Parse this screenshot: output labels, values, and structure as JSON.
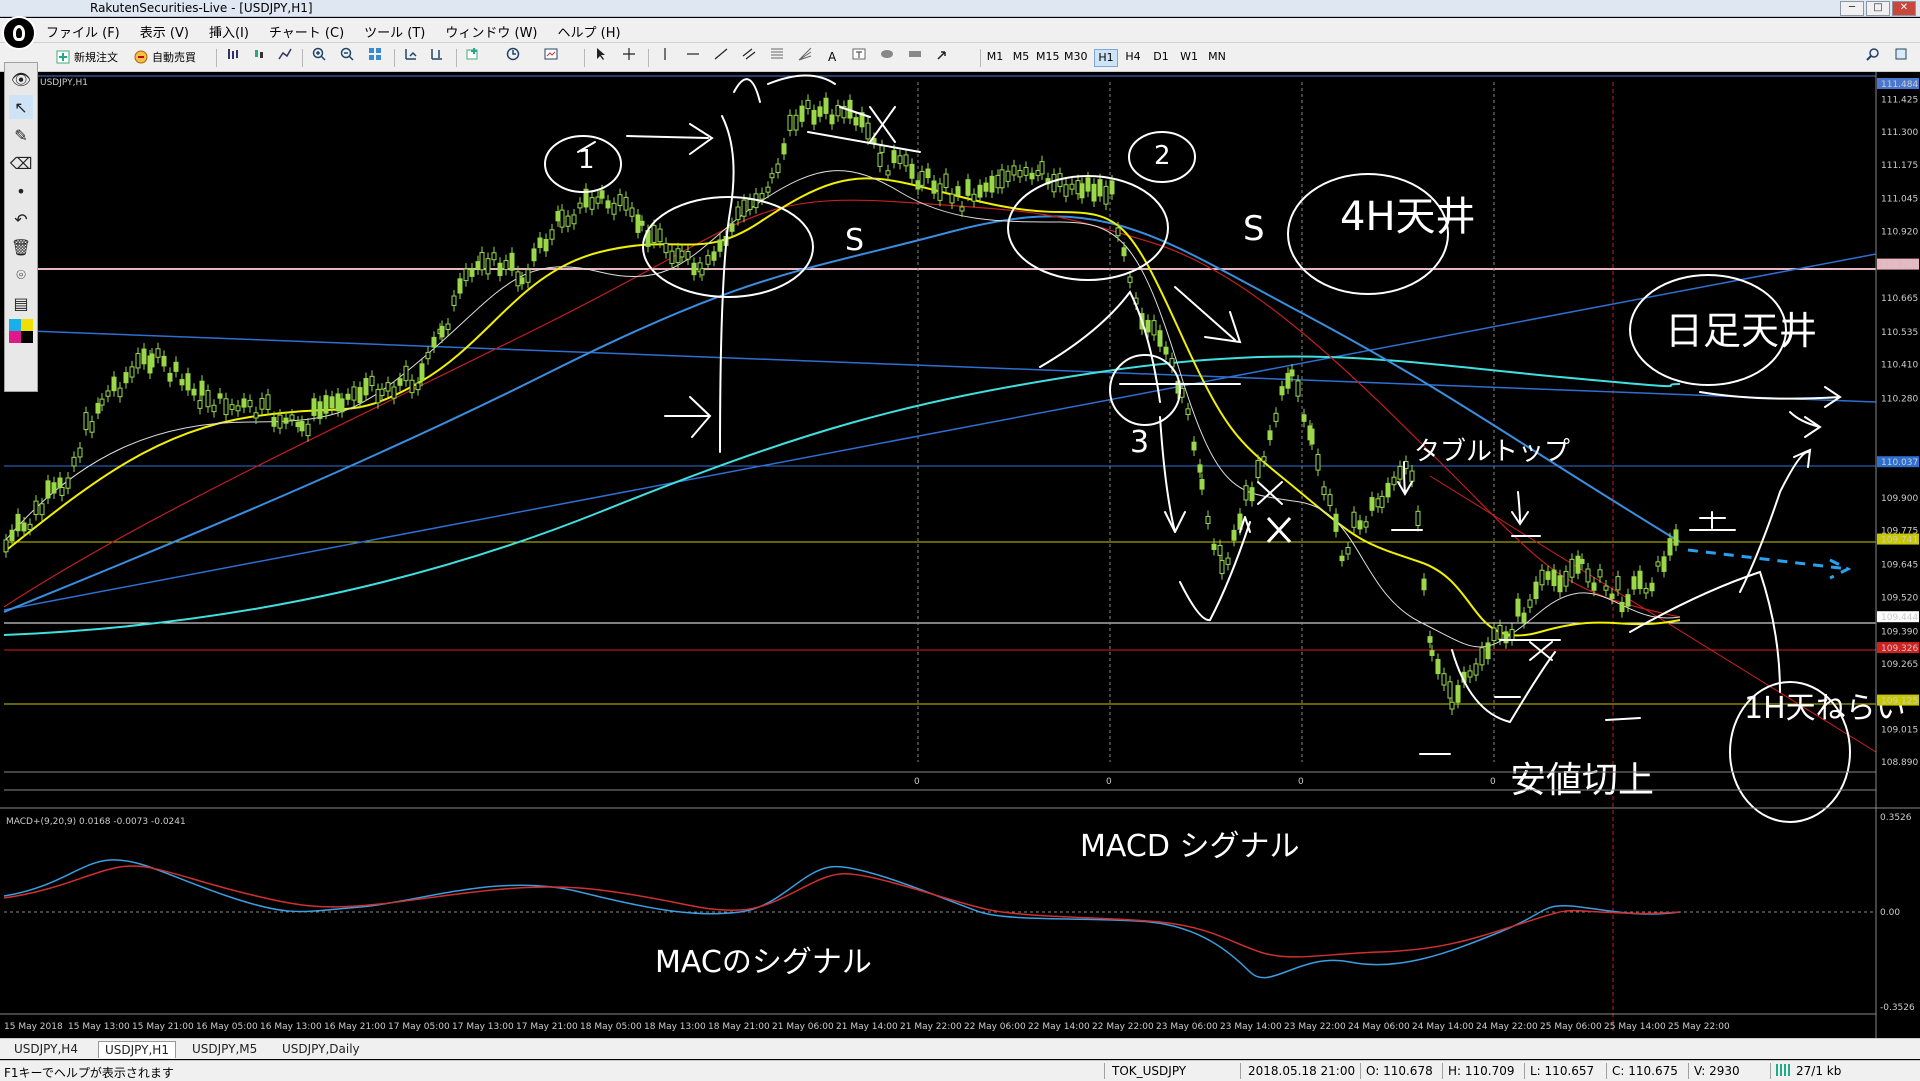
{
  "window": {
    "title": "RakutenSecurities-Live - [USDJPY,H1]"
  },
  "menu": [
    "ファイル (F)",
    "表示 (V)",
    "挿入(I)",
    "チャート (C)",
    "ツール (T)",
    "ウィンドウ (W)",
    "ヘルプ (H)"
  ],
  "toolbar": {
    "new_order": "新規注文",
    "auto_trade": "自動売買",
    "timeframes": [
      "M1",
      "M5",
      "M15",
      "M30",
      "H1",
      "H4",
      "D1",
      "W1",
      "MN"
    ],
    "active_timeframe": "H1"
  },
  "chart": {
    "symbol_label": "USDJPY,H1",
    "price_labels": [
      "111.484",
      "111.425",
      "111.300",
      "111.175",
      "111.045",
      "110.920",
      "110.793",
      "110.665",
      "110.535",
      "110.410",
      "110.280",
      "110.037",
      "109.900",
      "109.775",
      "109.741",
      "109.645",
      "109.520",
      "109.444",
      "109.390",
      "109.326",
      "109.265",
      "109.125",
      "109.015",
      "108.890"
    ],
    "time_labels": [
      "15 May 2018",
      "15 May 13:00",
      "15 May 21:00",
      "16 May 05:00",
      "16 May 13:00",
      "16 May 21:00",
      "17 May 05:00",
      "17 May 13:00",
      "17 May 21:00",
      "18 May 05:00",
      "18 May 13:00",
      "18 May 21:00",
      "21 May 06:00",
      "21 May 14:00",
      "21 May 22:00",
      "22 May 06:00",
      "22 May 14:00",
      "22 May 22:00",
      "23 May 06:00",
      "23 May 14:00",
      "23 May 22:00",
      "24 May 06:00",
      "24 May 14:00",
      "24 May 22:00",
      "25 May 06:00",
      "25 May 14:00",
      "25 May 22:00"
    ],
    "separator_zero": "0"
  },
  "indicator": {
    "label": "MACD+(9,20,9) 0.0168 -0.0073 -0.0241",
    "axis": [
      "0.3526",
      "0.00",
      "-0.3526"
    ]
  },
  "annotations": {
    "texts": [
      "S",
      "S",
      "4H天井",
      "日足天井",
      "タブルトップ",
      "安値切上",
      "1H天ねらい",
      "MACD シグナル",
      "MACのシグナル"
    ],
    "numbers": [
      "1",
      "2",
      "3"
    ]
  },
  "tabs": [
    "USDJPY,H4",
    "USDJPY,H1",
    "USDJPY,M5",
    "USDJPY,Daily"
  ],
  "active_tab": "USDJPY,H1",
  "status": {
    "help": "F1キーでヘルプが表示されます",
    "symbol": "TOK_USDJPY",
    "datetime": "2018.05.18 21:00",
    "open": "O: 110.678",
    "high": "H: 110.709",
    "low": "L: 110.657",
    "close": "C: 110.675",
    "volume": "V: 2930",
    "traffic": "27/1 kb"
  }
}
